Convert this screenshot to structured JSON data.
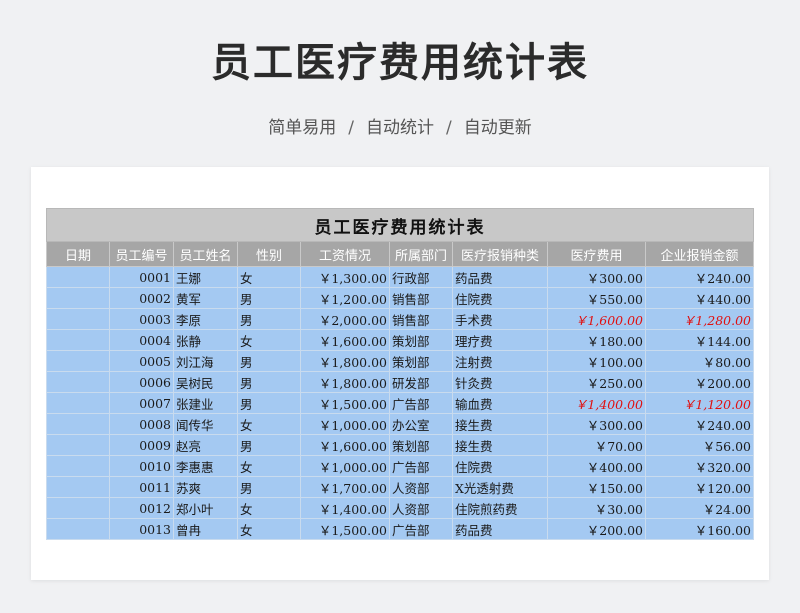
{
  "page": {
    "title": "员工医疗费用统计表",
    "subtitle_items": [
      "简单易用",
      "自动统计",
      "自动更新"
    ],
    "subtitle_separator": "/"
  },
  "sheet": {
    "title": "员工医疗费用统计表",
    "columns": [
      "日期",
      "员工编号",
      "员工姓名",
      "性别",
      "工资情况",
      "所属部门",
      "医疗报销种类",
      "医疗费用",
      "企业报销金额"
    ],
    "rows": [
      {
        "date": "",
        "id": "0001",
        "name": "王娜",
        "gender": "女",
        "salary": "￥1,300.00",
        "dept": "行政部",
        "type": "药品费",
        "cost": "￥300.00",
        "reimburse": "￥240.00",
        "highlight": false
      },
      {
        "date": "",
        "id": "0002",
        "name": "黄军",
        "gender": "男",
        "salary": "￥1,200.00",
        "dept": "销售部",
        "type": "住院费",
        "cost": "￥550.00",
        "reimburse": "￥440.00",
        "highlight": false
      },
      {
        "date": "",
        "id": "0003",
        "name": "李原",
        "gender": "男",
        "salary": "￥2,000.00",
        "dept": "销售部",
        "type": "手术费",
        "cost": "￥1,600.00",
        "reimburse": "￥1,280.00",
        "highlight": true
      },
      {
        "date": "",
        "id": "0004",
        "name": "张静",
        "gender": "女",
        "salary": "￥1,600.00",
        "dept": "策划部",
        "type": "理疗费",
        "cost": "￥180.00",
        "reimburse": "￥144.00",
        "highlight": false
      },
      {
        "date": "",
        "id": "0005",
        "name": "刘江海",
        "gender": "男",
        "salary": "￥1,800.00",
        "dept": "策划部",
        "type": "注射费",
        "cost": "￥100.00",
        "reimburse": "￥80.00",
        "highlight": false
      },
      {
        "date": "",
        "id": "0006",
        "name": "吴树民",
        "gender": "男",
        "salary": "￥1,800.00",
        "dept": "研发部",
        "type": "针灸费",
        "cost": "￥250.00",
        "reimburse": "￥200.00",
        "highlight": false
      },
      {
        "date": "",
        "id": "0007",
        "name": "张建业",
        "gender": "男",
        "salary": "￥1,500.00",
        "dept": "广告部",
        "type": "输血费",
        "cost": "￥1,400.00",
        "reimburse": "￥1,120.00",
        "highlight": true
      },
      {
        "date": "",
        "id": "0008",
        "name": "闻传华",
        "gender": "女",
        "salary": "￥1,000.00",
        "dept": "办公室",
        "type": "接生费",
        "cost": "￥300.00",
        "reimburse": "￥240.00",
        "highlight": false
      },
      {
        "date": "",
        "id": "0009",
        "name": "赵亮",
        "gender": "男",
        "salary": "￥1,600.00",
        "dept": "策划部",
        "type": "接生费",
        "cost": "￥70.00",
        "reimburse": "￥56.00",
        "highlight": false
      },
      {
        "date": "",
        "id": "0010",
        "name": "李惠惠",
        "gender": "女",
        "salary": "￥1,000.00",
        "dept": "广告部",
        "type": "住院费",
        "cost": "￥400.00",
        "reimburse": "￥320.00",
        "highlight": false
      },
      {
        "date": "",
        "id": "0011",
        "name": "苏爽",
        "gender": "男",
        "salary": "￥1,700.00",
        "dept": "人资部",
        "type": "X光透射费",
        "cost": "￥150.00",
        "reimburse": "￥120.00",
        "highlight": false
      },
      {
        "date": "",
        "id": "0012",
        "name": "郑小叶",
        "gender": "女",
        "salary": "￥1,400.00",
        "dept": "人资部",
        "type": "住院煎药费",
        "cost": "￥30.00",
        "reimburse": "￥24.00",
        "highlight": false
      },
      {
        "date": "",
        "id": "0013",
        "name": "曾冉",
        "gender": "女",
        "salary": "￥1,500.00",
        "dept": "广告部",
        "type": "药品费",
        "cost": "￥200.00",
        "reimburse": "￥160.00",
        "highlight": false
      }
    ]
  },
  "colors": {
    "header_bg": "#a6a6a6",
    "title_bg": "#c8c8c8",
    "row_bg": "#a4c9f2",
    "highlight_text": "#e01010"
  }
}
